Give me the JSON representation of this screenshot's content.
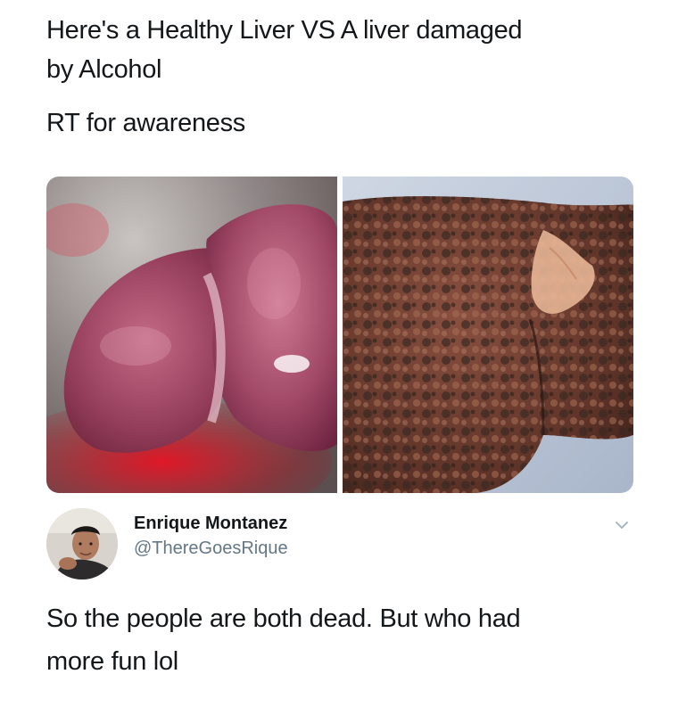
{
  "post": {
    "line1": "Here's a Healthy Liver VS A liver damaged",
    "line2": "by Alcohol",
    "line3": "RT for awareness"
  },
  "media": {
    "left_photo": "healthy-liver-photo",
    "right_photo": "damaged-liver-photo"
  },
  "reply": {
    "author_name": "Enrique Montanez",
    "author_handle": "@ThereGoesRique",
    "text_line1": "So the people are both dead. But who had",
    "text_line2": "more fun lol"
  },
  "icons": {
    "menu": "chevron-down-icon"
  },
  "colors": {
    "text": "#14171a",
    "handle": "#657786",
    "chevron": "#aab8c2"
  }
}
